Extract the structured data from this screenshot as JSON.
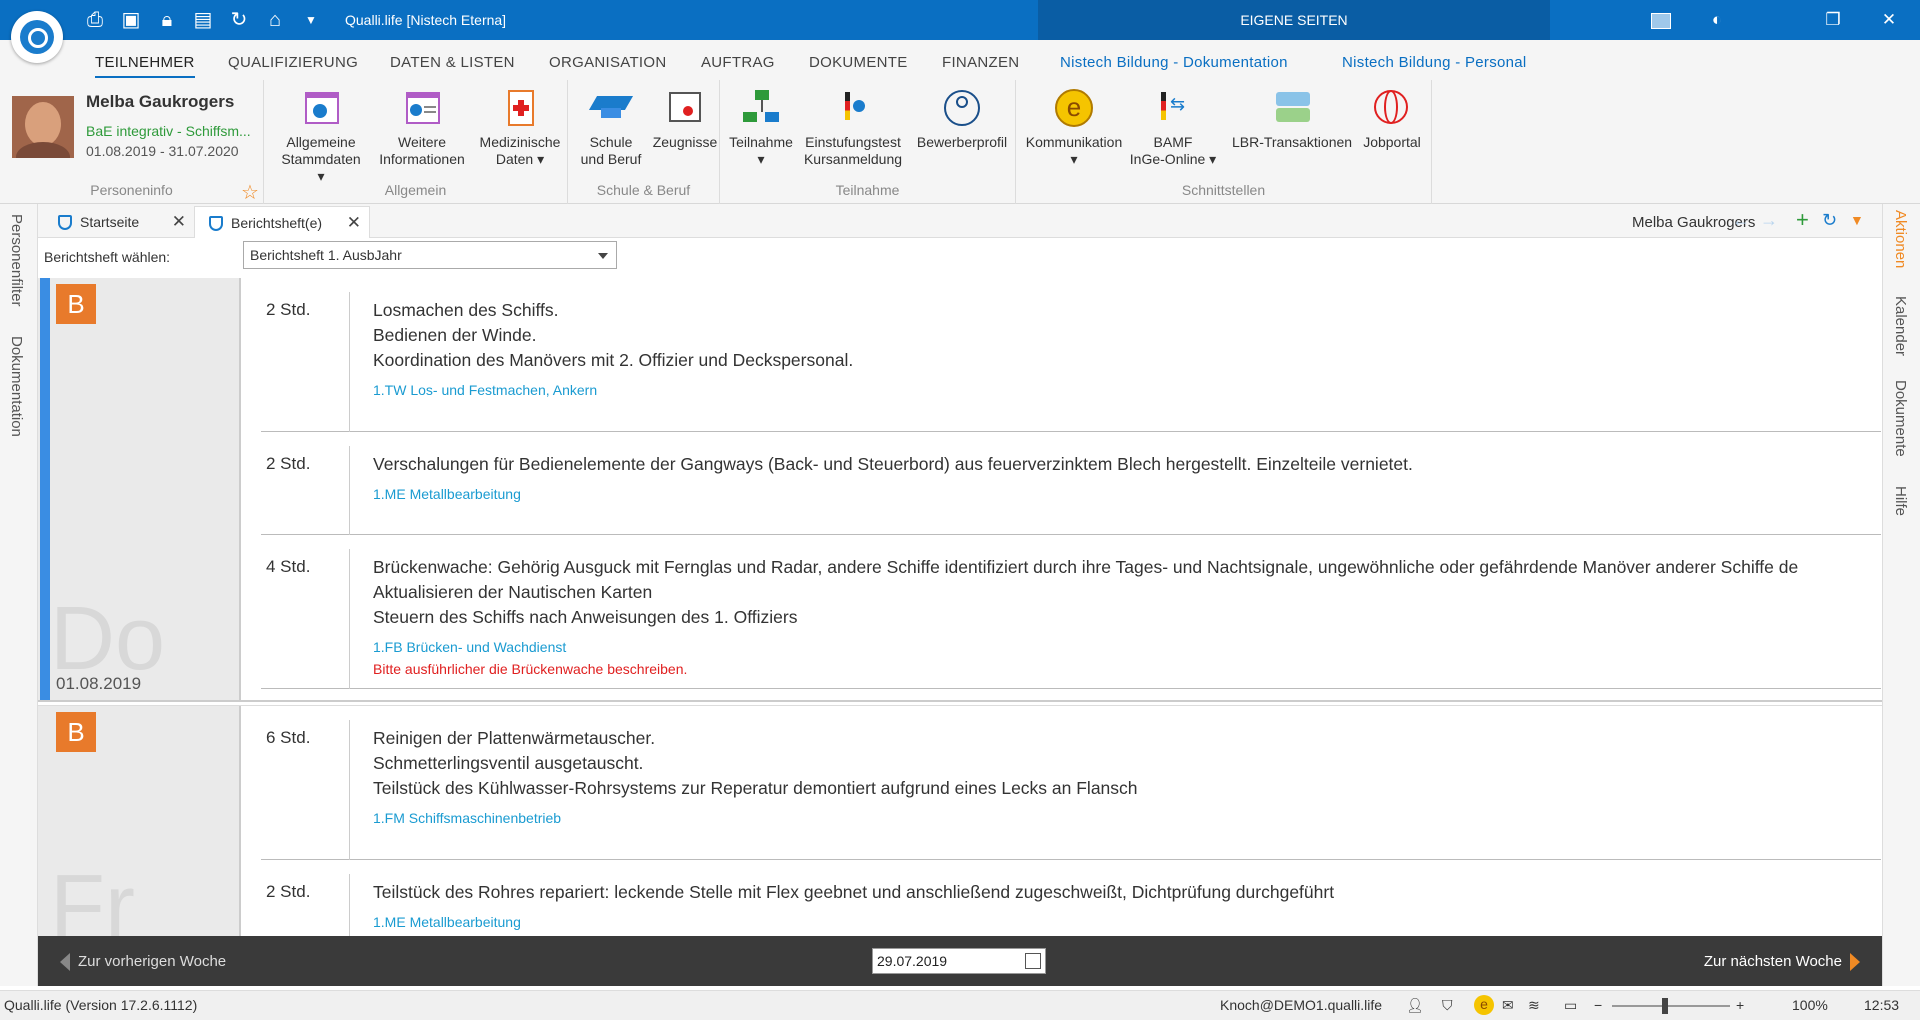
{
  "titlebar": {
    "title": "Qualli.life [Nistech Eterna]",
    "eigene_seiten": "EIGENE SEITEN"
  },
  "menu": [
    "TEILNEHMER",
    "QUALIFIZIERUNG",
    "DATEN & LISTEN",
    "ORGANISATION",
    "AUFTRAG",
    "DOKUMENTE",
    "FINANZEN",
    "Nistech Bildung - Dokumentation",
    "Nistech Bildung - Personal"
  ],
  "person": {
    "name": "Melba Gaukrogers",
    "course": "BaE integrativ - Schiffsm...",
    "period": "01.08.2019 - 31.07.2020",
    "group_label": "Personeninfo"
  },
  "ribbon": {
    "allgemein": {
      "label": "Allgemein",
      "b1": "Allgemeine",
      "b1b": "Stammdaten",
      "b2": "Weitere",
      "b2b": "Informationen",
      "b3": "Medizinische",
      "b3b": "Daten"
    },
    "schule": {
      "label": "Schule & Beruf",
      "b1": "Schule",
      "b1b": "und Beruf",
      "b2": "Zeugnisse"
    },
    "teilnahme": {
      "label": "Teilnahme",
      "b1": "Teilnahme",
      "b2": "Einstufungstest",
      "b2b": "Kursanmeldung",
      "b3": "Bewerberprofil"
    },
    "schnitt": {
      "label": "Schnittstellen",
      "b1": "Kommunikation",
      "b2": "BAMF",
      "b2b": "InGe-Online",
      "b3": "LBR-Transaktionen",
      "b4": "Jobportal"
    }
  },
  "sidebar_left": [
    "Personenfilter",
    "Dokumentation"
  ],
  "sidebar_right": [
    "Aktionen",
    "Kalender",
    "Dokumente",
    "Hilfe"
  ],
  "tabs": [
    {
      "label": "Startseite"
    },
    {
      "label": "Berichtsheft(e)"
    }
  ],
  "tab_user": "Melba Gaukrogers",
  "selector": {
    "label": "Berichtsheft wählen:",
    "value": "Berichtsheft 1. AusbJahr"
  },
  "days": [
    {
      "badge": "B",
      "name": "Do",
      "date": "01.08.2019",
      "entries": [
        {
          "hours": "2 Std.",
          "lines": [
            "Losmachen des Schiffs.",
            "Bedienen der Winde.",
            "Koordination des Manövers mit 2. Offizier und Deckspersonal."
          ],
          "topic": "1.TW Los- und Festmachen, Ankern"
        },
        {
          "hours": "2 Std.",
          "lines": [
            "Verschalungen für Bedienelemente der Gangways (Back- und Steuerbord) aus feuerverzinktem Blech hergestellt. Einzelteile vernietet."
          ],
          "topic": "1.ME Metallbearbeitung"
        },
        {
          "hours": "4 Std.",
          "lines": [
            "Brückenwache: Gehörig Ausguck mit Fernglas und Radar, andere Schiffe identifiziert durch ihre Tages- und Nachtsignale, ungewöhnliche oder gefährdende Manöver anderer Schiffe de",
            "Aktualisieren der Nautischen Karten",
            "Steuern des Schiffs nach Anweisungen des 1. Offiziers"
          ],
          "topic": "1.FB Brücken- und Wachdienst",
          "warning": "Bitte ausführlicher die Brückenwache beschreiben."
        }
      ]
    },
    {
      "badge": "B",
      "name": "Fr",
      "date": "",
      "entries": [
        {
          "hours": "6 Std.",
          "lines": [
            "Reinigen der Plattenwärmetauscher.",
            "Schmetterlingsventil ausgetauscht.",
            "Teilstück des Kühlwasser-Rohrsystems zur Reperatur demontiert aufgrund eines Lecks an Flansch"
          ],
          "topic": "1.FM Schiffsmaschinenbetrieb"
        },
        {
          "hours": "2 Std.",
          "lines": [
            "Teilstück des Rohres repariert: leckende Stelle mit Flex geebnet und anschließend zugeschweißt, Dichtprüfung durchgeführt"
          ],
          "topic": "1.ME Metallbearbeitung"
        }
      ]
    }
  ],
  "nav": {
    "prev": "Zur vorherigen Woche",
    "next": "Zur nächsten Woche",
    "date": "29.07.2019"
  },
  "status": {
    "version": "Qualli.life (Version 17.2.6.1112)",
    "user": "Knoch@DEMO1.qualli.life",
    "zoom": "100%",
    "time": "12:53"
  },
  "colors": {
    "primary": "#0a6fc2",
    "accent": "#f08a24",
    "badge": "#e87a2b",
    "topic": "#1a9bd1",
    "warning": "#e02020"
  }
}
